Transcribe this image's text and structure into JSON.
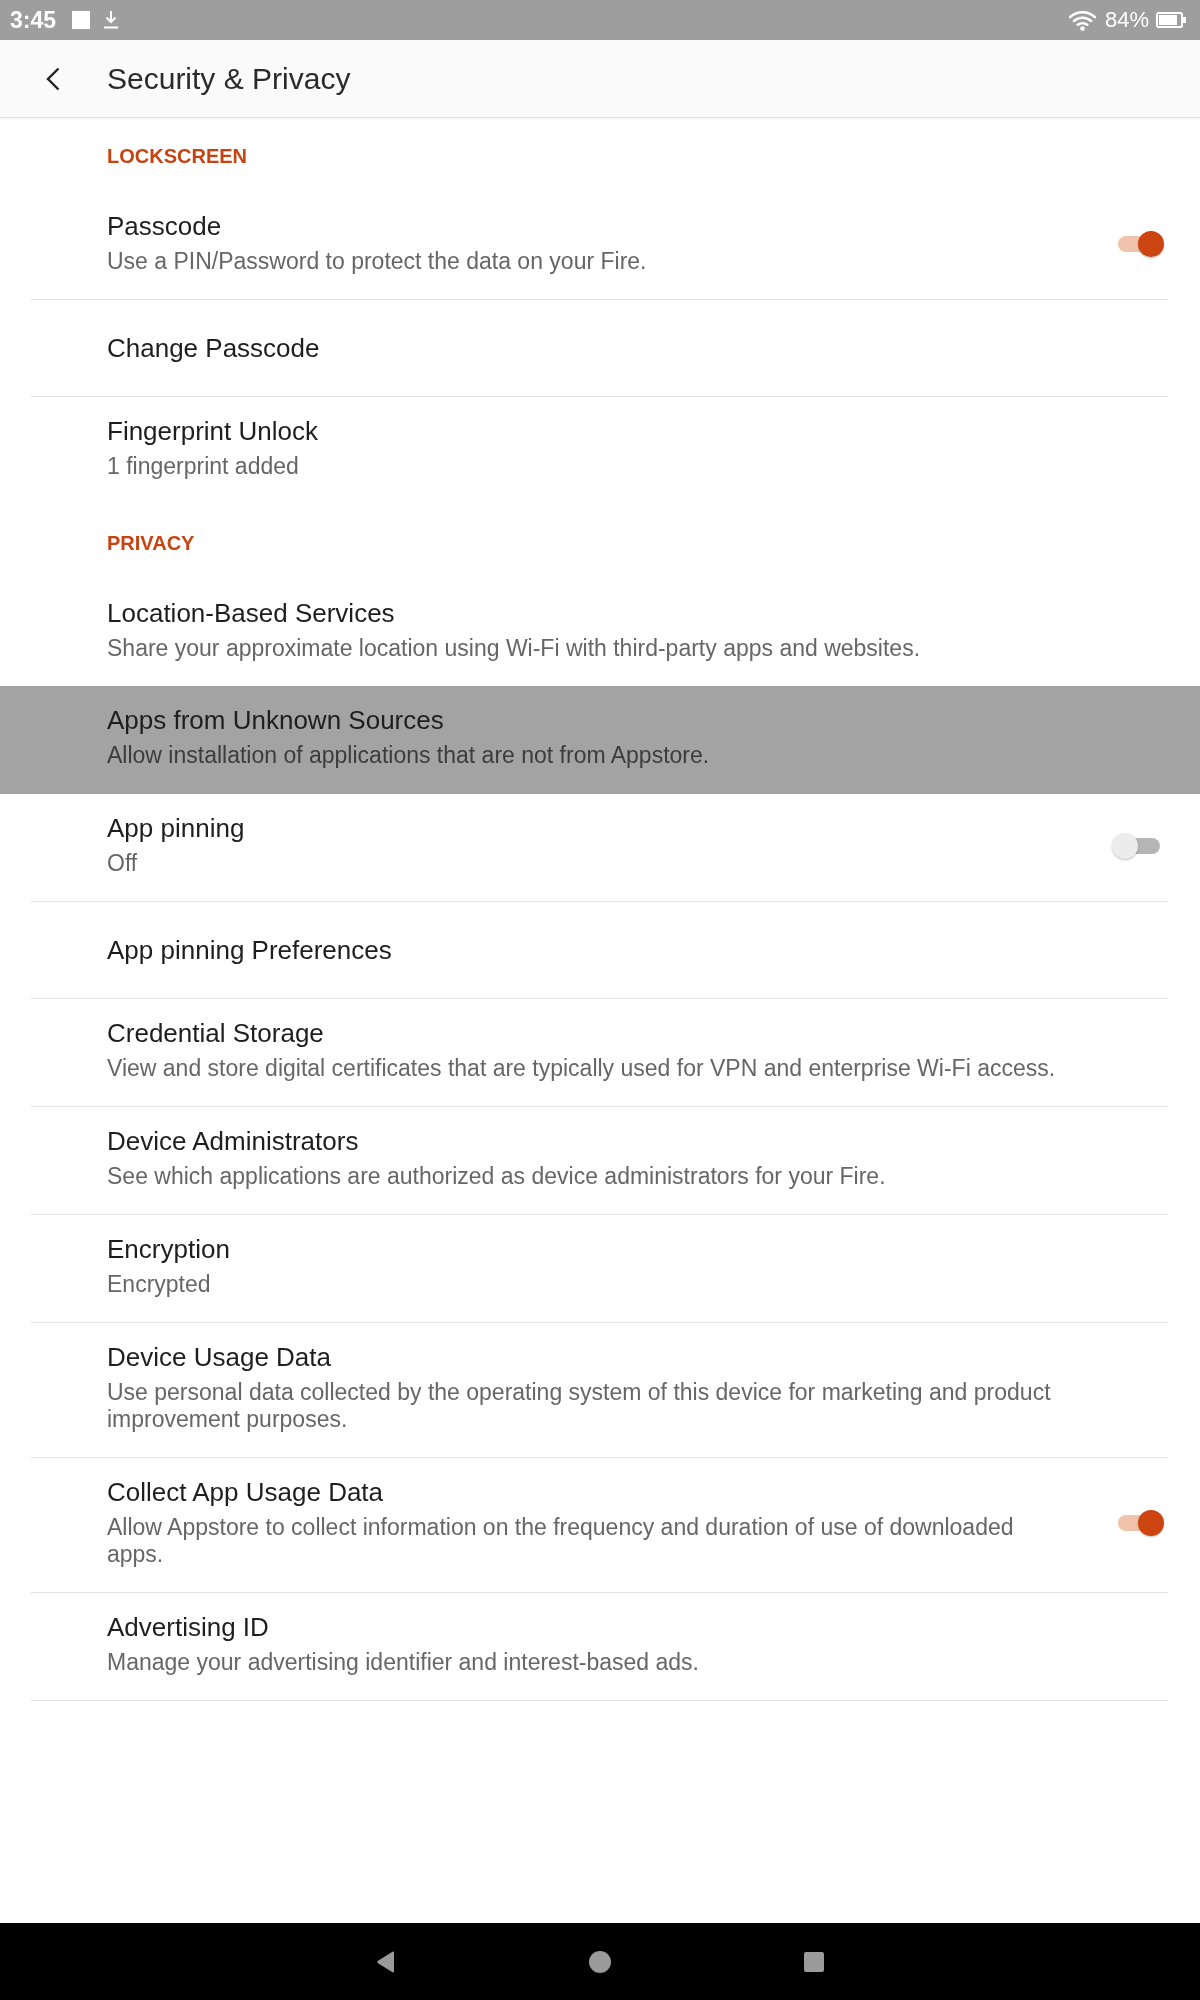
{
  "status_bar": {
    "time": "3:45",
    "battery": "84%"
  },
  "header": {
    "title": "Security & Privacy"
  },
  "sections": [
    {
      "title": "LOCKSCREEN",
      "items": [
        {
          "kind": "toggle",
          "title": "Passcode",
          "subtitle": "Use a PIN/Password to protect the data on your Fire.",
          "on": true,
          "selected": false
        },
        {
          "kind": "link",
          "title": "Change Passcode",
          "selected": false
        },
        {
          "kind": "link",
          "title": "Fingerprint Unlock",
          "subtitle": "1 fingerprint added",
          "selected": false
        }
      ]
    },
    {
      "title": "PRIVACY",
      "items": [
        {
          "kind": "link",
          "title": "Location-Based Services",
          "subtitle": "Share your approximate location using Wi-Fi with third-party apps and websites.",
          "selected": false
        },
        {
          "kind": "link",
          "title": "Apps from Unknown Sources",
          "subtitle": "Allow installation of applications that are not from Appstore.",
          "selected": true
        },
        {
          "kind": "toggle",
          "title": "App pinning",
          "subtitle": "Off",
          "on": false,
          "selected": false
        },
        {
          "kind": "link",
          "title": "App pinning Preferences",
          "selected": false
        },
        {
          "kind": "link",
          "title": "Credential Storage",
          "subtitle": "View and store digital certificates that are typically used for VPN and enterprise Wi-Fi access.",
          "selected": false
        },
        {
          "kind": "link",
          "title": "Device Administrators",
          "subtitle": "See which applications are authorized as device administrators for your Fire.",
          "selected": false
        },
        {
          "kind": "link",
          "title": "Encryption",
          "subtitle": "Encrypted",
          "selected": false
        },
        {
          "kind": "link",
          "title": "Device Usage Data",
          "subtitle": "Use personal data collected by the operating system of this device for marketing and product improvement purposes.",
          "selected": false
        },
        {
          "kind": "toggle",
          "title": "Collect App Usage Data",
          "subtitle": "Allow Appstore to collect information on the frequency and duration of use of downloaded apps.",
          "on": true,
          "selected": false
        },
        {
          "kind": "link",
          "title": "Advertising ID",
          "subtitle": "Manage your advertising identifier and interest-based ads.",
          "selected": false
        }
      ]
    }
  ]
}
